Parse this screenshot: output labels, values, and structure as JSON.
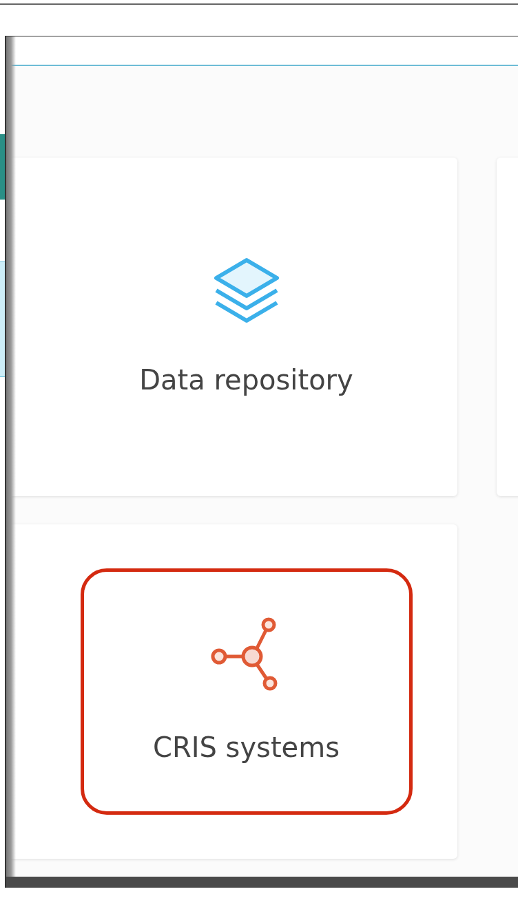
{
  "cards": [
    {
      "title": "Data repository",
      "kind": "layers",
      "highlighted": false
    },
    {
      "title": "CRIS systems",
      "kind": "network",
      "highlighted": true
    }
  ]
}
